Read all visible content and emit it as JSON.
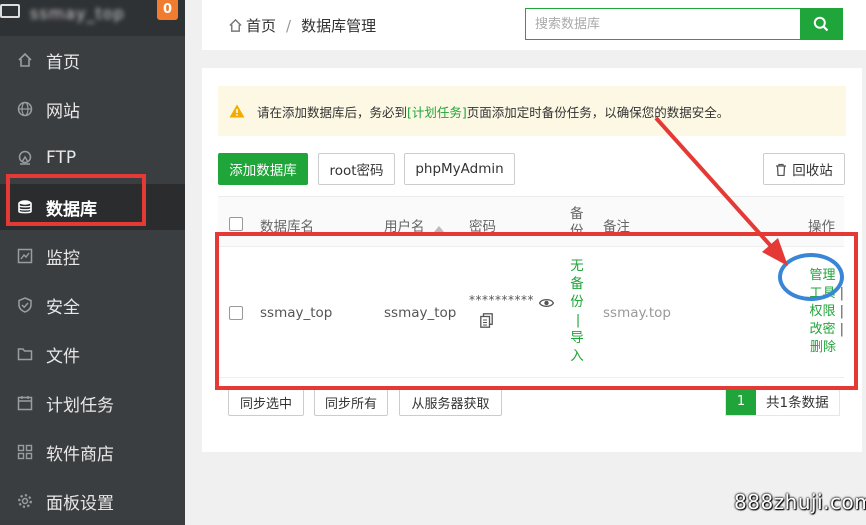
{
  "sidebar": {
    "host": "ssmay_top",
    "badge": "0",
    "items": [
      {
        "label": "首页",
        "icon": "home-icon"
      },
      {
        "label": "网站",
        "icon": "globe-icon"
      },
      {
        "label": "FTP",
        "icon": "ftp-icon"
      },
      {
        "label": "数据库",
        "icon": "database-icon"
      },
      {
        "label": "监控",
        "icon": "monitor-icon"
      },
      {
        "label": "安全",
        "icon": "shield-icon"
      },
      {
        "label": "文件",
        "icon": "folder-icon"
      },
      {
        "label": "计划任务",
        "icon": "calendar-icon"
      },
      {
        "label": "软件商店",
        "icon": "apps-icon"
      },
      {
        "label": "面板设置",
        "icon": "gear-icon"
      }
    ]
  },
  "header": {
    "home": "首页",
    "sep": "/",
    "current": "数据库管理",
    "search_placeholder": "搜索数据库"
  },
  "notice": {
    "prefix": "请在添加数据库后，务必到",
    "link": "[计划任务]",
    "suffix": "页面添加定时备份任务，以确保您的数据安全。"
  },
  "toolbar": {
    "add": "添加数据库",
    "root_pwd": "root密码",
    "pma": "phpMyAdmin",
    "recycle": "回收站"
  },
  "table": {
    "headers": {
      "name": "数据库名",
      "user": "用户名",
      "password": "密码",
      "backup": "备份",
      "note": "备注",
      "ops": "操作"
    },
    "rows": [
      {
        "name": "ssmay_top",
        "user": "ssmay_top",
        "password": "**********",
        "backup_none": "无备份",
        "backup_sep": "|",
        "backup_import": "导入",
        "note": "ssmay.top",
        "ops": [
          "管理",
          "工具",
          "权限",
          "改密",
          "删除"
        ]
      }
    ]
  },
  "footer": {
    "sync_selected": "同步选中",
    "sync_all": "同步所有",
    "fetch_server": "从服务器获取",
    "page": "1",
    "total": "共1条数据"
  },
  "watermark": "888zhuji.com",
  "colors": {
    "accent": "#20a53a",
    "annotation_red": "#e53935",
    "annotation_blue": "#3a86d6",
    "sidebar": "#3b3e41"
  }
}
